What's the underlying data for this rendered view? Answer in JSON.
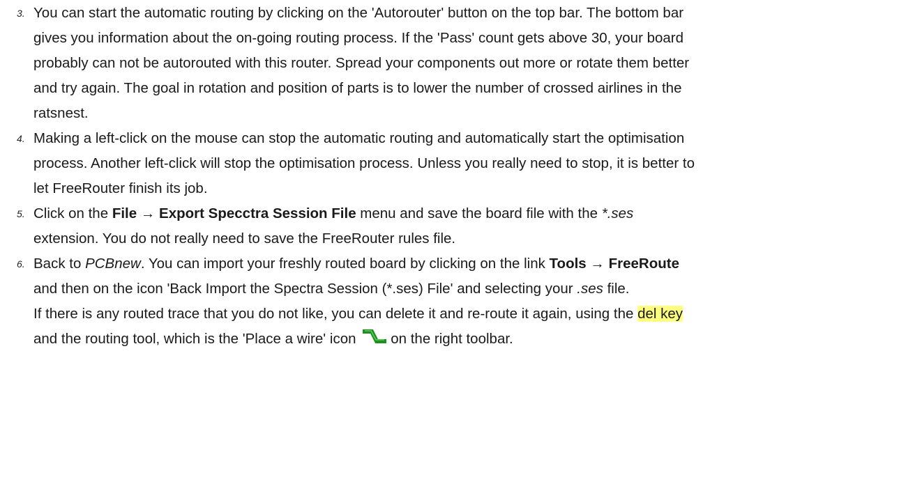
{
  "colors": {
    "highlight": "#ffff80",
    "wire_icon": "#1f8f1f"
  },
  "steps": [
    {
      "number": "3.",
      "lines": [
        "You can start the automatic routing by clicking on the 'Autorouter' button on the top bar. The bottom bar",
        "gives you information about the on-going routing process. If the 'Pass' count gets above 30, your board",
        "probably can not be autorouted with this router. Spread your components out more or rotate them better",
        "and try again. The goal in rotation and position of parts is to lower the number of crossed airlines in the",
        "ratsnest."
      ]
    },
    {
      "number": "4.",
      "lines": [
        "Making a left-click on the mouse can stop the automatic routing and automatically start the optimisation",
        "process. Another left-click will stop the optimisation process. Unless you really need to stop, it is better to",
        "let FreeRouter finish its job."
      ]
    },
    {
      "number": "5.",
      "l1_a": "Click on the ",
      "l1_file": "File",
      "l1_arrow": " → ",
      "l1_export": "Export Specctra Session File",
      "l1_b": " menu and save the board file with the ",
      "l1_ext": "*.ses",
      "l2": "extension. You do not really need to save the FreeRouter rules file."
    },
    {
      "number": "6.",
      "l1_a": "Back to ",
      "l1_pcbnew": "PCBnew",
      "l1_b": ". You can import your freshly routed board by clicking on the link ",
      "l1_tools": "Tools",
      "l1_arrow": " → ",
      "l1_freeroute": "FreeRoute",
      "l2_a": "and then on the icon 'Back Import the Spectra Session (*.ses) File' and selecting your ",
      "l2_ext": ".ses",
      "l2_b": " file.",
      "l3_a": "If there is any routed trace that you do not like, you can delete it and re-route it again, using the ",
      "l3_key": "del key",
      "l4_a": "and the routing tool, which is the 'Place a wire' icon",
      "l4_icon": "place-wire-icon",
      "l4_b": "on the right toolbar."
    }
  ]
}
